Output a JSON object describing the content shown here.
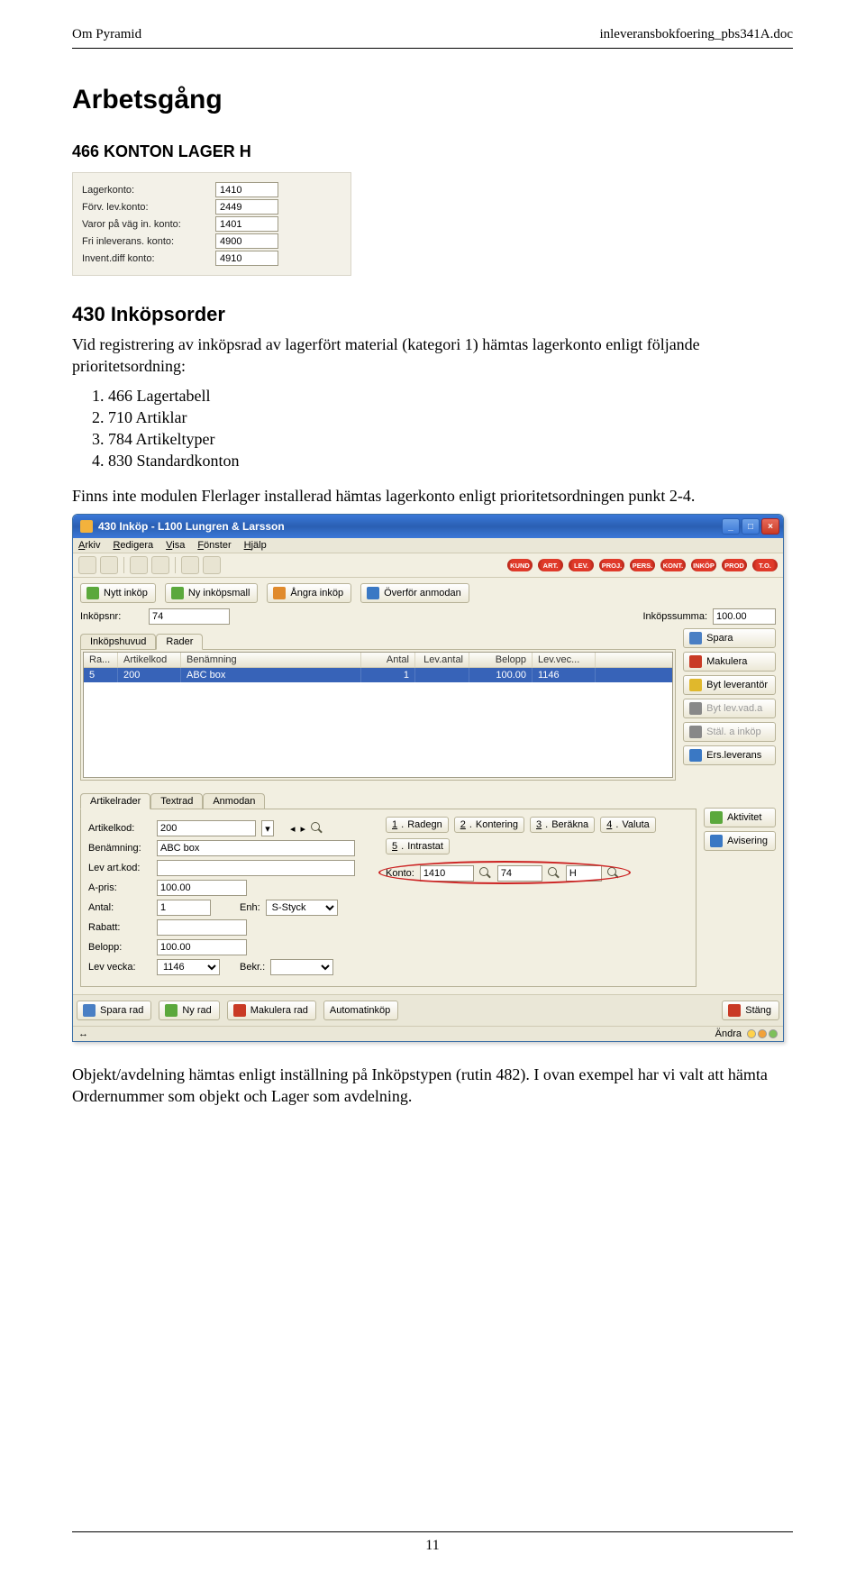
{
  "header": {
    "left": "Om Pyramid",
    "right": "inleveransbokfoering_pbs341A.doc"
  },
  "h1": "Arbetsgång",
  "h2": "466 KONTON LAGER H",
  "konton": {
    "rows": [
      {
        "label": "Lagerkonto:",
        "value": "1410"
      },
      {
        "label": "Förv. lev.konto:",
        "value": "2449"
      },
      {
        "label": "Varor på väg in. konto:",
        "value": "1401"
      },
      {
        "label": "Fri inleverans. konto:",
        "value": "4900"
      },
      {
        "label": "Invent.diff konto:",
        "value": "4910"
      }
    ]
  },
  "h3": "430 Inköpsorder",
  "para1": "Vid registrering av inköpsrad av lagerfört material (kategori 1) hämtas lagerkonto enligt följande prioritetsordning:",
  "list": [
    "466 Lagertabell",
    "710 Artiklar",
    "784 Artikeltyper",
    "830 Standardkonton"
  ],
  "para2": "Finns inte modulen Flerlager installerad hämtas lagerkonto enligt prioritetsordningen punkt 2-4.",
  "win": {
    "title": "430 Inköp - L100 Lungren & Larsson",
    "menu": [
      "Arkiv",
      "Redigera",
      "Visa",
      "Fönster",
      "Hjälp"
    ],
    "chips": [
      "KUND",
      "ART.",
      "LEV.",
      "PROJ.",
      "PERS.",
      "KONT.",
      "INKÖP",
      "PROD",
      "T.O."
    ],
    "actions": [
      {
        "label": "Nytt inköp",
        "icon": "ic-green"
      },
      {
        "label": "Ny inköpsmall",
        "icon": "ic-green"
      },
      {
        "label": "Ångra inköp",
        "icon": "ic-orange"
      },
      {
        "label": "Överför anmodan",
        "icon": "ic-blue"
      }
    ],
    "inkopsnr_label": "Inköpsnr:",
    "inkopsnr": "74",
    "sum_label": "Inköpssumma:",
    "sum": "100.00",
    "tabs_top": [
      "Inköpshuvud",
      "Rader"
    ],
    "grid_cols": [
      "Ra...",
      "Artikelkod",
      "Benämning",
      "Antal",
      "Lev.antal",
      "Belopp",
      "Lev.vec..."
    ],
    "grid_row0": [
      "5",
      "200",
      "ABC box",
      "1",
      "",
      "100.00",
      "1146"
    ],
    "side": [
      {
        "label": "Spara",
        "icon": "ic-save"
      },
      {
        "label": "Makulera",
        "icon": "ic-red"
      },
      {
        "label": "Byt leverantör",
        "icon": "ic-yellow"
      },
      {
        "label": "Byt lev.vad.a",
        "icon": "ic-gray",
        "disabled": true
      },
      {
        "label": "Stäl. a inköp",
        "icon": "ic-gray",
        "disabled": true
      },
      {
        "label": "Ers.leverans",
        "icon": "ic-blue"
      }
    ],
    "tabs_low": [
      "Artikelrader",
      "Textrad",
      "Anmodan"
    ],
    "quick": [
      {
        "k": "1",
        "label": "Radegn"
      },
      {
        "k": "2",
        "label": "Kontering"
      },
      {
        "k": "3",
        "label": "Beräkna"
      },
      {
        "k": "4",
        "label": "Valuta"
      },
      {
        "k": "5",
        "label": "Intrastat"
      }
    ],
    "side2": [
      {
        "label": "Aktivitet",
        "icon": "ic-green"
      },
      {
        "label": "Avisering",
        "icon": "ic-blue"
      }
    ],
    "form": {
      "artikelkod_l": "Artikelkod:",
      "artikelkod": "200",
      "benamning_l": "Benämning:",
      "benamning": "ABC box",
      "levartkod_l": "Lev art.kod:",
      "levartkod": "",
      "apris_l": "A-pris:",
      "apris": "100.00",
      "antal_l": "Antal:",
      "antal": "1",
      "enh_l": "Enh:",
      "enh": "S-Styck",
      "rabatt_l": "Rabatt:",
      "rabatt": "",
      "belopp_l": "Belopp:",
      "belopp": "100.00",
      "levvecka_l": "Lev vecka:",
      "levvecka": "1146",
      "bekr_l": "Bekr.:",
      "bekr": "",
      "konto_l": "Konto:",
      "konto_a": "1410",
      "konto_b": "74",
      "konto_c": "H"
    },
    "bottom": [
      {
        "label": "Spara rad",
        "icon": "ic-save"
      },
      {
        "label": "Ny rad",
        "icon": "ic-green"
      },
      {
        "label": "Makulera rad",
        "icon": "ic-red"
      },
      {
        "label": "Automatinköp",
        "icon": ""
      }
    ],
    "stang": "Stäng",
    "status": "Ändra"
  },
  "para3": "Objekt/avdelning hämtas enligt inställning på Inköpstypen (rutin 482). I ovan exempel har vi valt att hämta Ordernummer som objekt och Lager som avdelning.",
  "page_number": "11"
}
